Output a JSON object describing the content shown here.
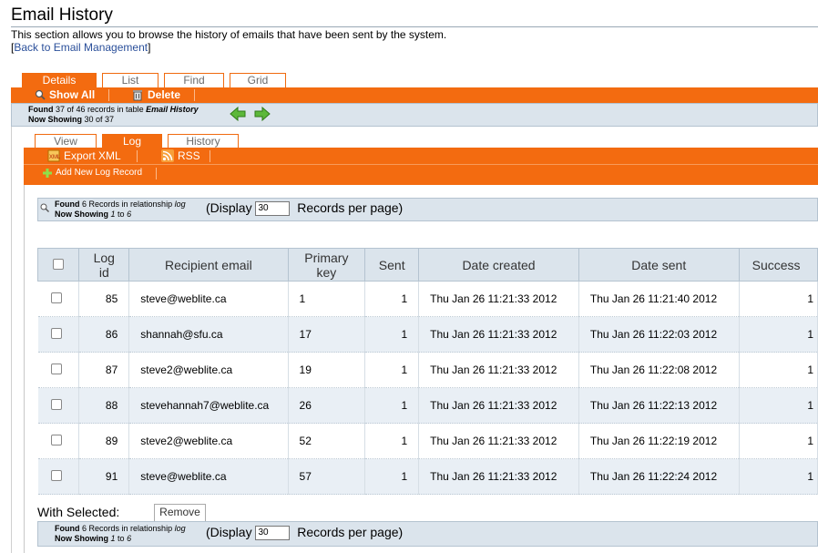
{
  "page": {
    "title": "Email History",
    "description": "This section allows you to browse the history of emails that have been sent by the system.",
    "back_prefix": "[",
    "back_link": "Back to Email Management",
    "back_suffix": "]"
  },
  "main_tabs": [
    "Details",
    "List",
    "Find",
    "Grid"
  ],
  "toolbar": {
    "show_all": "Show All",
    "delete": "Delete"
  },
  "found_bar": {
    "found_label": "Found",
    "found_text": "37 of 46 records in table",
    "table_name": "Email History",
    "showing_label": "Now Showing",
    "showing_text": "30 of 37"
  },
  "sub_tabs": [
    "View",
    "Log",
    "History"
  ],
  "sub_toolbar": {
    "export_xml": "Export XML",
    "rss": "RSS",
    "add_new": "Add New Log Record"
  },
  "related_found": {
    "found_label": "Found",
    "found_text": "6 Records in relationship",
    "relationship": "log",
    "showing_label": "Now Showing",
    "range_start": "1",
    "to": "to",
    "range_end": "6",
    "display_label": "(Display",
    "per_page": "30",
    "per_page_suffix": "Records per page)"
  },
  "table": {
    "headers": [
      "Log id",
      "Recipient email",
      "Primary key",
      "Sent",
      "Date created",
      "Date sent",
      "Success"
    ],
    "header_lines": {
      "log_id": [
        "Log",
        "id"
      ],
      "primary_key": [
        "Primary",
        "key"
      ]
    },
    "rows": [
      {
        "id": "85",
        "email": "steve@weblite.ca",
        "pk": "1",
        "sent": "1",
        "created": "Thu Jan 26 11:21:33 2012",
        "date_sent": "Thu Jan 26 11:21:40 2012",
        "success": "1"
      },
      {
        "id": "86",
        "email": "shannah@sfu.ca",
        "pk": "17",
        "sent": "1",
        "created": "Thu Jan 26 11:21:33 2012",
        "date_sent": "Thu Jan 26 11:22:03 2012",
        "success": "1"
      },
      {
        "id": "87",
        "email": "steve2@weblite.ca",
        "pk": "19",
        "sent": "1",
        "created": "Thu Jan 26 11:21:33 2012",
        "date_sent": "Thu Jan 26 11:22:08 2012",
        "success": "1"
      },
      {
        "id": "88",
        "email": "stevehannah7@weblite.ca",
        "pk": "26",
        "sent": "1",
        "created": "Thu Jan 26 11:21:33 2012",
        "date_sent": "Thu Jan 26 11:22:13 2012",
        "success": "1"
      },
      {
        "id": "89",
        "email": "steve2@weblite.ca",
        "pk": "52",
        "sent": "1",
        "created": "Thu Jan 26 11:21:33 2012",
        "date_sent": "Thu Jan 26 11:22:19 2012",
        "success": "1"
      },
      {
        "id": "91",
        "email": "steve@weblite.ca",
        "pk": "57",
        "sent": "1",
        "created": "Thu Jan 26 11:21:33 2012",
        "date_sent": "Thu Jan 26 11:22:24 2012",
        "success": "1"
      }
    ]
  },
  "with_selected": {
    "label": "With Selected:",
    "remove": "Remove"
  },
  "colors": {
    "orange": "#f36b10",
    "panel": "#dbe4ec",
    "row_alt": "#e9eff5",
    "link": "#2a4f9a"
  }
}
